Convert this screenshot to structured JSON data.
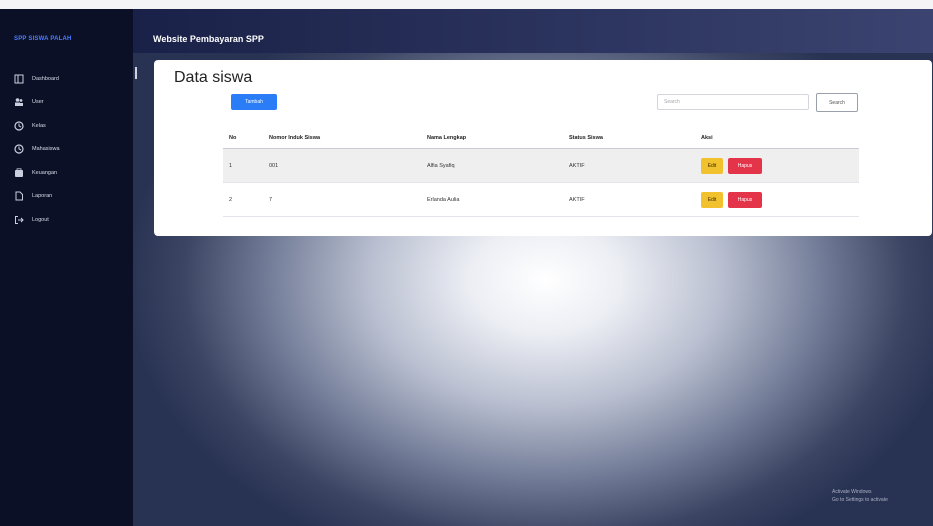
{
  "sidebar": {
    "brand": "SPP SISWA PALAH",
    "items": [
      {
        "label": "Dashboard",
        "icon": "dashboard-icon"
      },
      {
        "label": "User",
        "icon": "users-icon"
      },
      {
        "label": "Kelas",
        "icon": "clock-icon"
      },
      {
        "label": "Mahasiswa",
        "icon": "clock-icon"
      },
      {
        "label": "Keuangan",
        "icon": "wallet-icon"
      },
      {
        "label": "Laporan",
        "icon": "document-icon"
      },
      {
        "label": "Logout",
        "icon": "logout-icon"
      }
    ]
  },
  "header": {
    "title": "Website Pembayaran SPP"
  },
  "main": {
    "title": "Data siswa",
    "add_label": "Tambah",
    "search_placeholder": "Search",
    "search_button": "Search",
    "table": {
      "headers": [
        "No",
        "Nomor Induk Siswa",
        "Nama Lengkap",
        "Status Siswa",
        "Aksi"
      ],
      "rows": [
        {
          "no": "1",
          "nis": "001",
          "nama": "Alfia Syafiq",
          "status": "AKTIF",
          "edit": "Edit",
          "hapus": "Hapus"
        },
        {
          "no": "2",
          "nis": "7",
          "nama": "Erlanda Aulia",
          "status": "AKTIF",
          "edit": "Edit",
          "hapus": "Hapus"
        }
      ]
    }
  },
  "watermark": {
    "line1": "Activate Windows",
    "line2": "Go to Settings to activate"
  },
  "colors": {
    "sidebar": "#0b1026",
    "primary": "#2a7df7",
    "warning": "#f2c12e",
    "danger": "#e3344a"
  }
}
